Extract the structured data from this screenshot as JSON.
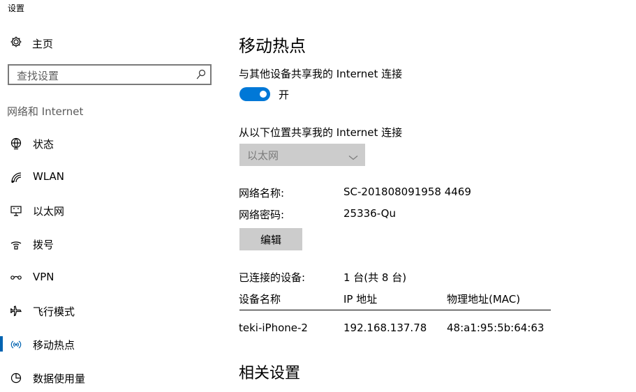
{
  "window": {
    "title": "设置"
  },
  "sidebar": {
    "home": {
      "label": "主页",
      "icon": "gear-icon"
    },
    "search": {
      "placeholder": "查找设置",
      "icon": "search-icon"
    },
    "section": "网络和 Internet",
    "items": [
      {
        "label": "状态",
        "icon": "globe-icon"
      },
      {
        "label": "WLAN",
        "icon": "wifi-icon"
      },
      {
        "label": "以太网",
        "icon": "ethernet-icon"
      },
      {
        "label": "拨号",
        "icon": "dialup-icon"
      },
      {
        "label": "VPN",
        "icon": "vpn-icon"
      },
      {
        "label": "飞行模式",
        "icon": "airplane-icon"
      },
      {
        "label": "移动热点",
        "icon": "hotspot-icon",
        "selected": true
      },
      {
        "label": "数据使用量",
        "icon": "data-usage-icon"
      }
    ],
    "accent": "#0063b1"
  },
  "main": {
    "title": "移动热点",
    "share_label": "与其他设备共享我的 Internet 连接",
    "toggle": {
      "state": "开",
      "on": true,
      "color": "#0078d7"
    },
    "share_from_label": "从以下位置共享我的 Internet 连接",
    "share_from_value": "以太网",
    "network_name_label": "网络名称:",
    "network_name_value": "SC-201808091958 4469",
    "network_password_label": "网络密码:",
    "network_password_value": "25336-Qu",
    "edit_button": "编辑",
    "connected_label": "已连接的设备:",
    "connected_value": "1 台(共 8 台)",
    "table": {
      "headers": [
        "设备名称",
        "IP 地址",
        "物理地址(MAC)"
      ],
      "rows": [
        [
          "teki-iPhone-2",
          "192.168.137.78",
          "48:a1:95:5b:64:63"
        ]
      ]
    },
    "related_title": "相关设置"
  }
}
